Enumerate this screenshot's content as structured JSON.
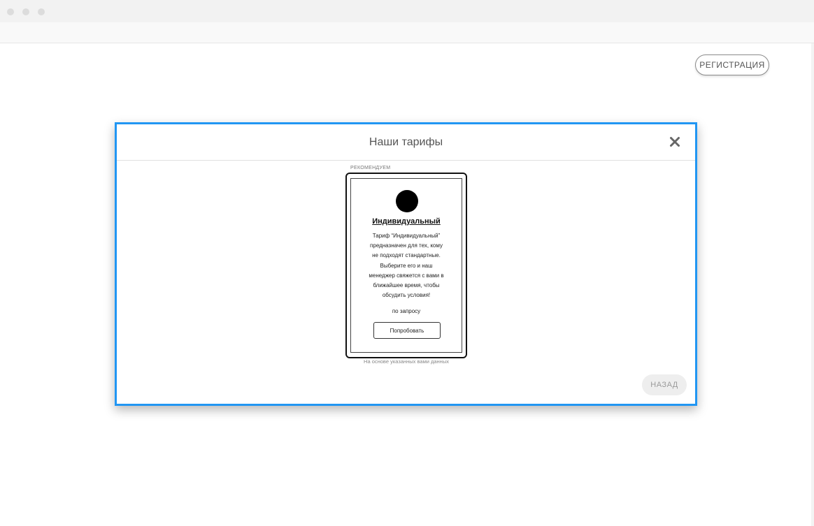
{
  "header": {
    "register_label": "РЕГИСТРАЦИЯ"
  },
  "modal": {
    "title": "Наши тарифы",
    "close_icon": "close-icon",
    "recommend_label": "РЕКОМЕНДУЕМ",
    "tariff": {
      "avatar_icon": "circle-avatar",
      "name": "Индивидуальный",
      "description_lines": [
        "Тариф “Индивидуальный”",
        "предназначен для тех, кому",
        "не подходят стандартные.",
        "Выберите его и наш",
        "менеджер свяжется с вами в",
        "ближайшее время, чтобы",
        "обсудить условия!"
      ],
      "price": "по запросу",
      "try_label": "Попробовать"
    },
    "basis_note": "На основе указанных вами данных",
    "back_label": "НАЗАД"
  },
  "colors": {
    "modal_border": "#2196f3",
    "back_button_bg": "#eeeeee"
  }
}
